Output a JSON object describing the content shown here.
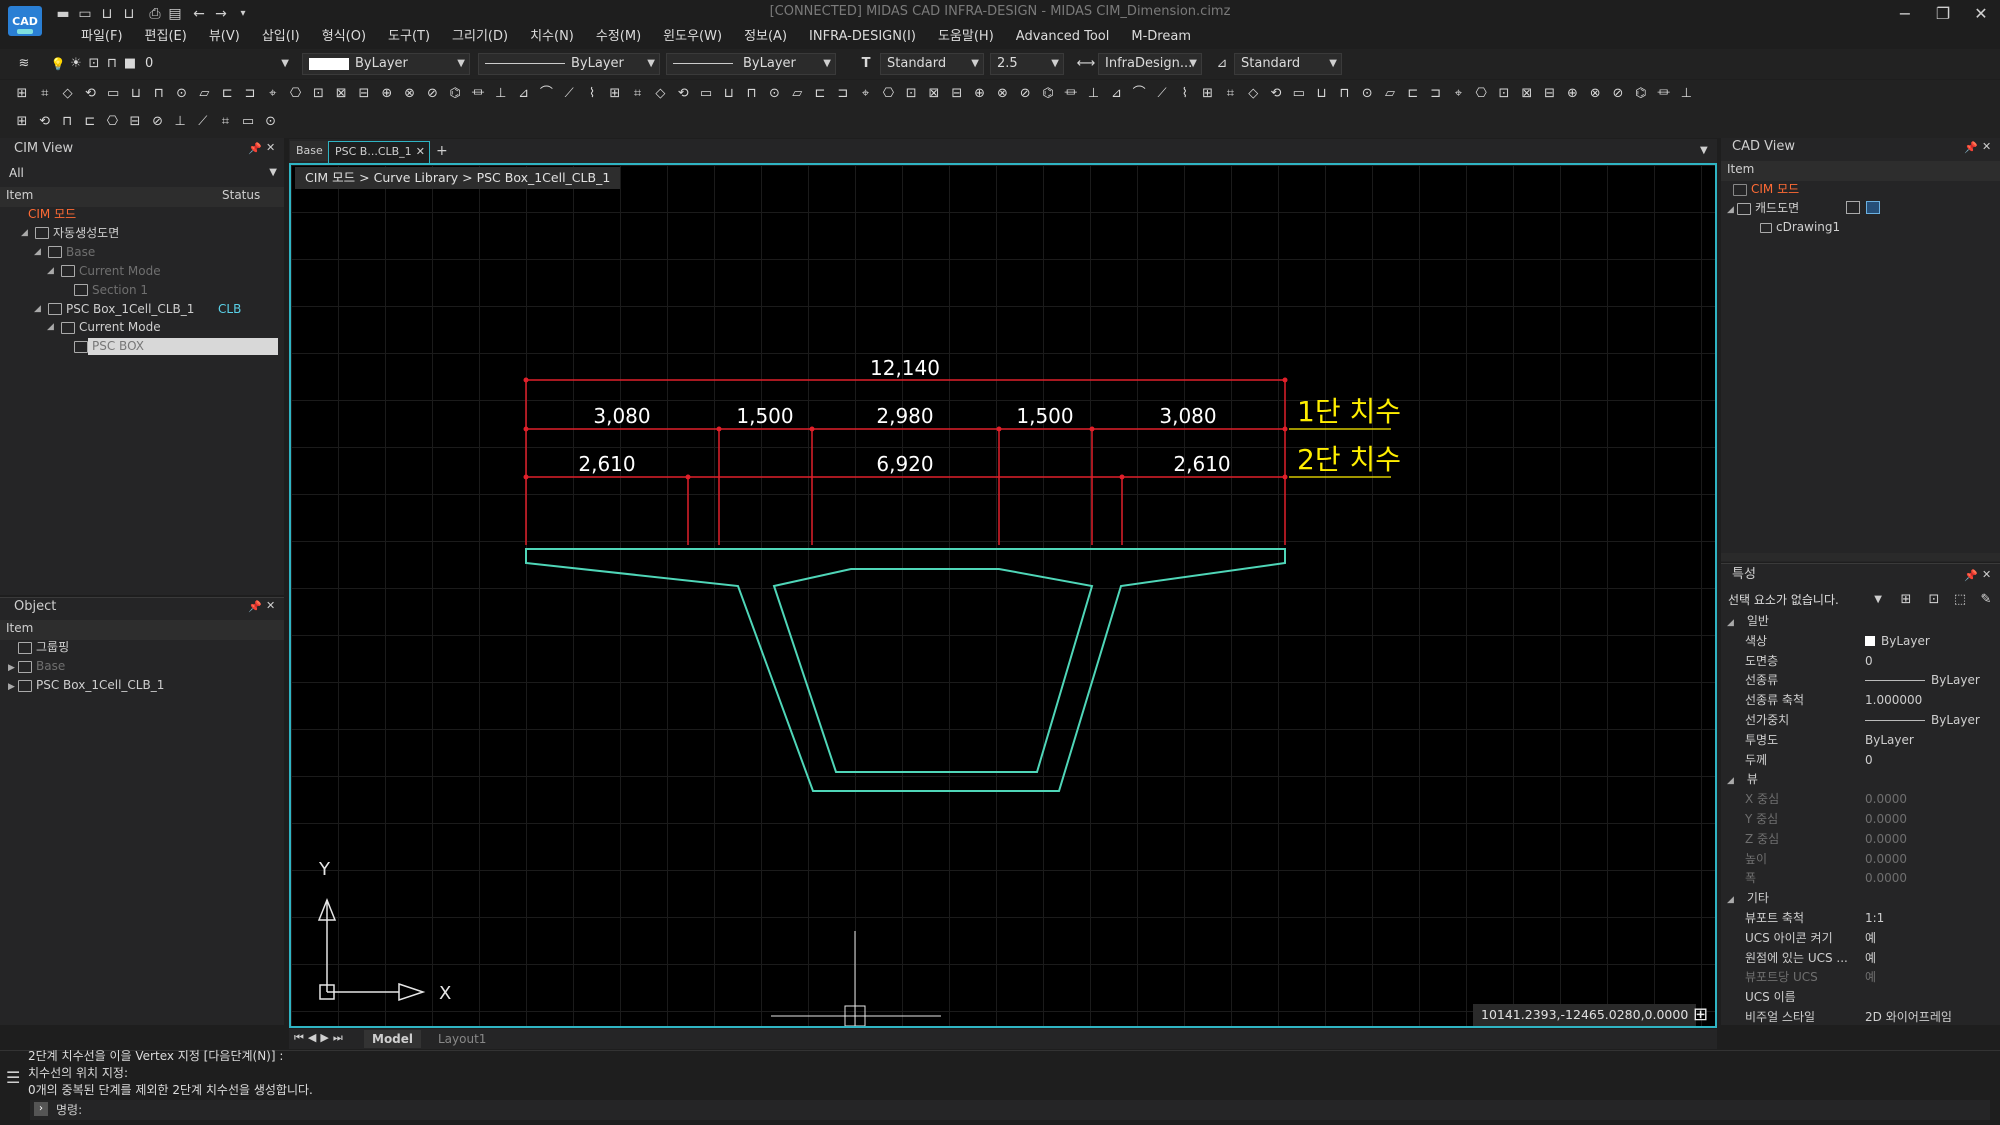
{
  "window": {
    "logo_text": "CAD",
    "title": "[CONNECTED] MIDAS CAD INFRA-DESIGN - MIDAS CIM_Dimension.cimz",
    "controls": [
      "−",
      "❐",
      "✕"
    ]
  },
  "menu": [
    "파일(F)",
    "편집(E)",
    "뷰(V)",
    "삽입(I)",
    "형식(O)",
    "도구(T)",
    "그리기(D)",
    "치수(N)",
    "수정(M)",
    "윈도우(W)",
    "정보(A)",
    "INFRA-DESIGN(I)",
    "도움말(H)",
    "Advanced Tool",
    "M-Dream"
  ],
  "toolbar": {
    "layer_value": "0",
    "color_value": "ByLayer",
    "linetype_value": "ByLayer",
    "lineweight_value": "ByLayer",
    "textstyle_value": "Standard",
    "textheight_value": "2.5",
    "dimstyle_value": "InfraDesign...",
    "tablestyle_value": "Standard"
  },
  "cim_view": {
    "title": "CIM View",
    "filter": "All",
    "col_item": "Item",
    "col_status": "Status",
    "tree": [
      {
        "label": "CIM 모드",
        "indent": 0,
        "style": "orange",
        "status": ""
      },
      {
        "label": "자동생성도면",
        "indent": 1,
        "style": "normal",
        "status": ""
      },
      {
        "label": "Base",
        "indent": 2,
        "style": "dim",
        "status": ""
      },
      {
        "label": "Current Mode",
        "indent": 3,
        "style": "dim",
        "status": ""
      },
      {
        "label": "Section 1",
        "indent": 4,
        "style": "dim",
        "status": ""
      },
      {
        "label": "PSC Box_1Cell_CLB_1",
        "indent": 2,
        "style": "normal",
        "status": "CLB"
      },
      {
        "label": "Current Mode",
        "indent": 3,
        "style": "normal",
        "status": ""
      },
      {
        "label": "PSC BOX",
        "indent": 4,
        "style": "selected",
        "status": ""
      }
    ]
  },
  "object_panel": {
    "title": "Object",
    "col_item": "Item",
    "tree": [
      {
        "label": "그룹핑",
        "style": "normal"
      },
      {
        "label": "Base",
        "style": "dim"
      },
      {
        "label": "PSC Box_1Cell_CLB_1",
        "style": "normal"
      }
    ]
  },
  "tabs": [
    {
      "label": "Base",
      "active": false
    },
    {
      "label": "PSC B...CLB_1",
      "active": true
    }
  ],
  "breadcrumb": "CIM 모드 > Curve Library > PSC Box_1Cell_CLB_1",
  "drawing": {
    "dim_total": "12,140",
    "dim_row1": [
      "3,080",
      "1,500",
      "2,980",
      "1,500",
      "3,080"
    ],
    "dim_row2": [
      "2,610",
      "6,920",
      "2,610"
    ],
    "label1": "1단 치수",
    "label2": "2단 치수",
    "axis_y": "Y",
    "axis_x": "X"
  },
  "coordinates": "10141.2393,-12465.0280,0.0000",
  "layout_tabs": [
    "Model",
    "Layout1"
  ],
  "command_lines": [
    "2단계 치수선을 이을 Vertex 지정 [다음단계(N)] :",
    "치수선의 위치 지정:",
    "0개의 중복된 단계를 제외한 2단계 치수선을 생성합니다."
  ],
  "command_prompt": "명령:",
  "cad_view": {
    "title": "CAD View",
    "col_item": "Item",
    "tree": [
      {
        "label": "CIM 모드",
        "style": "orange"
      },
      {
        "label": "캐드도면",
        "style": "normal"
      },
      {
        "label": "cDrawing1",
        "style": "normal"
      }
    ]
  },
  "properties": {
    "title": "특성",
    "selection": "선택 요소가 없습니다.",
    "sections": [
      {
        "name": "일반",
        "rows": [
          {
            "k": "색상",
            "v": "ByLayer"
          },
          {
            "k": "도면층",
            "v": "0"
          },
          {
            "k": "선종류",
            "v": "ByLayer"
          },
          {
            "k": "선종류 축척",
            "v": "1.000000"
          },
          {
            "k": "선가중치",
            "v": "ByLayer"
          },
          {
            "k": "투명도",
            "v": "ByLayer"
          },
          {
            "k": "두께",
            "v": "0"
          }
        ]
      },
      {
        "name": "뷰",
        "rows": [
          {
            "k": "X 중심",
            "v": "0.0000"
          },
          {
            "k": "Y 중심",
            "v": "0.0000"
          },
          {
            "k": "Z 중심",
            "v": "0.0000"
          },
          {
            "k": "높이",
            "v": "0.0000"
          },
          {
            "k": "폭",
            "v": "0.0000"
          }
        ]
      },
      {
        "name": "기타",
        "rows": [
          {
            "k": "뷰포트 축척",
            "v": "1:1"
          },
          {
            "k": "UCS 아이콘 켜기",
            "v": "예"
          },
          {
            "k": "원점에 있는 UCS ...",
            "v": "예"
          },
          {
            "k": "뷰포트당 UCS",
            "v": "예"
          },
          {
            "k": "UCS 이름",
            "v": ""
          },
          {
            "k": "비주얼 스타일",
            "v": "2D 와이어프레임"
          }
        ]
      }
    ]
  },
  "colors": {
    "accent": "#2fb4c3",
    "dimension": "#e0202a",
    "section": "#4fd6b8",
    "label": "#ffee00"
  }
}
